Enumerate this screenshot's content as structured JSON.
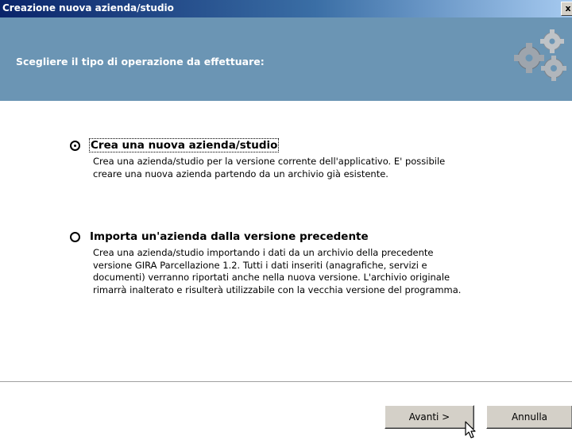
{
  "window": {
    "title": "Creazione nuova azienda/studio",
    "close_glyph": "x"
  },
  "header": {
    "instruction": "Scegliere il tipo di operazione da effettuare:",
    "icon": "gears-icon"
  },
  "options": [
    {
      "label": "Crea una nuova azienda/studio",
      "description": "Crea una azienda/studio per la versione corrente dell'applicativo. E' possibile creare una nuova azienda partendo da un archivio già esistente.",
      "selected": true
    },
    {
      "label": "Importa un'azienda dalla versione precedente",
      "description": "Crea una azienda/studio importando i dati da un archivio della precedente versione GIRA Parcellazione 1.2. Tutti i dati inseriti (anagrafiche, servizi e documenti) verranno riportati anche nella nuova versione. L'archivio originale rimarrà inalterato e risulterà utilizzabile con la vecchia versione del programma.",
      "selected": false
    }
  ],
  "buttons": {
    "next_label": "Avanti >",
    "cancel_label": "Annulla"
  },
  "colors": {
    "header_bg": "#6b95b4",
    "titlebar_start": "#0a246a",
    "button_face": "#d4d0c8"
  }
}
